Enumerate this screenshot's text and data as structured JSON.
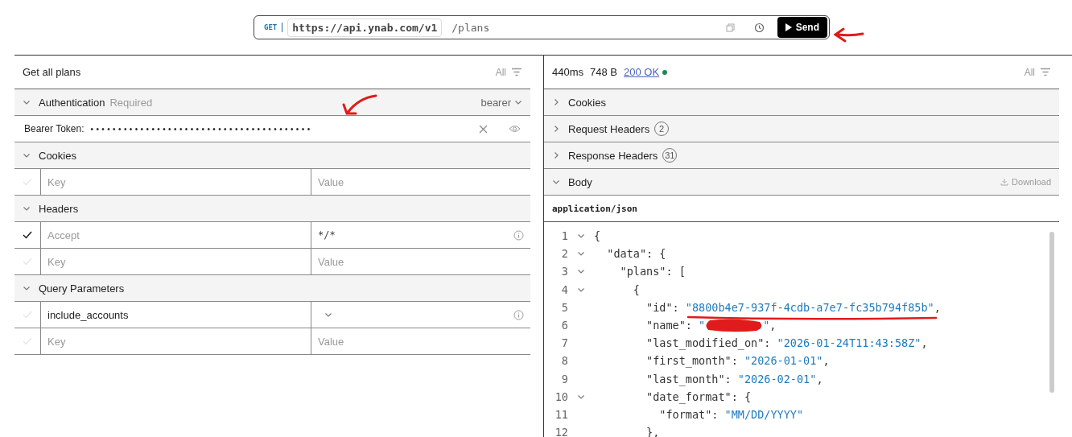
{
  "request": {
    "method": "GET",
    "base_url": "https://api.ynab.com/v1",
    "path": "/plans",
    "send": "Send"
  },
  "left": {
    "title": "Get all plans",
    "filter": "All",
    "sections": [
      {
        "title": "Authentication",
        "badge": "Required",
        "scheme": "bearer",
        "expanded": true,
        "rows": [
          {
            "kind": "token",
            "label": "Bearer Token:",
            "value": "••••••••••••••••••••••••••••••••••••••••"
          }
        ]
      },
      {
        "title": "Cookies",
        "expanded": true,
        "rows": [
          {
            "kind": "new",
            "checked": false,
            "key_placeholder": "Key",
            "value_placeholder": "Value"
          }
        ]
      },
      {
        "title": "Headers",
        "expanded": true,
        "rows": [
          {
            "kind": "pair",
            "checked": true,
            "default": true,
            "key": "Accept",
            "value": "*/*",
            "info": true
          },
          {
            "kind": "new",
            "checked": false,
            "key_placeholder": "Key",
            "value_placeholder": "Value"
          }
        ]
      },
      {
        "title": "Query Parameters",
        "expanded": true,
        "rows": [
          {
            "kind": "select",
            "checked": false,
            "key": "include_accounts",
            "info": true
          },
          {
            "kind": "new",
            "checked": false,
            "key_placeholder": "Key",
            "value_placeholder": "Value"
          }
        ]
      }
    ]
  },
  "right": {
    "time": "440ms",
    "size": "748 B",
    "status": "200 OK",
    "filter": "All",
    "sections": [
      {
        "title": "Cookies",
        "expanded": false
      },
      {
        "title": "Request Headers",
        "count": "2",
        "expanded": false
      },
      {
        "title": "Response Headers",
        "count": "31",
        "expanded": false
      },
      {
        "title": "Body",
        "expanded": true,
        "download": "Download"
      }
    ],
    "content_type": "application/json",
    "code": [
      {
        "number": "1",
        "foldable": true,
        "tokens": [
          {
            "kind": "punct",
            "text": "{"
          }
        ]
      },
      {
        "number": "2",
        "foldable": true,
        "tokens": [
          {
            "kind": "key",
            "text": "  \"data\""
          },
          {
            "kind": "punct",
            "text": ": {"
          }
        ]
      },
      {
        "number": "3",
        "foldable": true,
        "tokens": [
          {
            "kind": "key",
            "text": "    \"plans\""
          },
          {
            "kind": "punct",
            "text": ": ["
          }
        ]
      },
      {
        "number": "4",
        "foldable": true,
        "tokens": [
          {
            "kind": "punct",
            "text": "      {"
          }
        ]
      },
      {
        "number": "5",
        "foldable": false,
        "tokens": [
          {
            "kind": "key",
            "text": "        \"id\""
          },
          {
            "kind": "punct",
            "text": ": "
          },
          {
            "kind": "string",
            "text": "\"8800b4e7-937f-4cdb-a7e7-fc35b794f85b\""
          },
          {
            "kind": "punct",
            "text": ","
          }
        ]
      },
      {
        "number": "6",
        "foldable": false,
        "tokens": [
          {
            "kind": "key",
            "text": "        \"name\""
          },
          {
            "kind": "punct",
            "text": ": "
          },
          {
            "kind": "string",
            "text": "\""
          },
          {
            "kind": "redacted"
          },
          {
            "kind": "string",
            "text": "\""
          },
          {
            "kind": "punct",
            "text": ","
          }
        ]
      },
      {
        "number": "7",
        "foldable": false,
        "tokens": [
          {
            "kind": "key",
            "text": "        \"last_modified_on\""
          },
          {
            "kind": "punct",
            "text": ": "
          },
          {
            "kind": "string",
            "text": "\"2026-01-24T11:43:58Z\""
          },
          {
            "kind": "punct",
            "text": ","
          }
        ]
      },
      {
        "number": "8",
        "foldable": false,
        "tokens": [
          {
            "kind": "key",
            "text": "        \"first_month\""
          },
          {
            "kind": "punct",
            "text": ": "
          },
          {
            "kind": "string",
            "text": "\"2026-01-01\""
          },
          {
            "kind": "punct",
            "text": ","
          }
        ]
      },
      {
        "number": "9",
        "foldable": false,
        "tokens": [
          {
            "kind": "key",
            "text": "        \"last_month\""
          },
          {
            "kind": "punct",
            "text": ": "
          },
          {
            "kind": "string",
            "text": "\"2026-02-01\""
          },
          {
            "kind": "punct",
            "text": ","
          }
        ]
      },
      {
        "number": "10",
        "foldable": true,
        "tokens": [
          {
            "kind": "key",
            "text": "        \"date_format\""
          },
          {
            "kind": "punct",
            "text": ": {"
          }
        ]
      },
      {
        "number": "11",
        "foldable": false,
        "tokens": [
          {
            "kind": "key",
            "text": "          \"format\""
          },
          {
            "kind": "punct",
            "text": ": "
          },
          {
            "kind": "string",
            "text": "\"MM/DD/YYYY\""
          }
        ]
      },
      {
        "number": "12",
        "foldable": false,
        "tokens": [
          {
            "kind": "punct",
            "text": "        },"
          }
        ]
      }
    ]
  }
}
